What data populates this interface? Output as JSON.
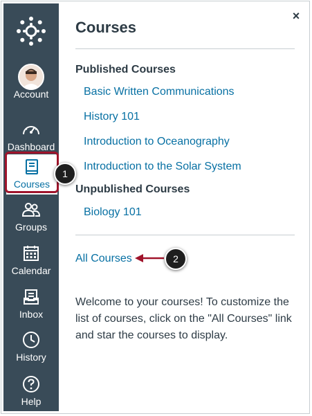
{
  "nav": {
    "items": [
      {
        "label": "Account",
        "icon": "user-avatar"
      },
      {
        "label": "Dashboard",
        "icon": "dashboard-icon"
      },
      {
        "label": "Courses",
        "icon": "courses-icon"
      },
      {
        "label": "Groups",
        "icon": "groups-icon"
      },
      {
        "label": "Calendar",
        "icon": "calendar-icon"
      },
      {
        "label": "Inbox",
        "icon": "inbox-icon"
      },
      {
        "label": "History",
        "icon": "history-icon"
      },
      {
        "label": "Help",
        "icon": "help-icon"
      }
    ]
  },
  "tray": {
    "title": "Courses",
    "close_label": "×",
    "published_heading": "Published Courses",
    "published": [
      "Basic Written Communications",
      "History 101",
      "Introduction to Oceanography",
      "Introduction to the Solar System"
    ],
    "unpublished_heading": "Unpublished Courses",
    "unpublished": [
      "Biology 101"
    ],
    "all_courses_label": "All Courses",
    "welcome_text": "Welcome to your courses! To customize the list of courses, click on the \"All Courses\" link and star the courses to display."
  },
  "callouts": [
    "1",
    "2"
  ],
  "colors": {
    "nav_bg": "#394b58",
    "link": "#0770a3",
    "highlight": "#a0142b",
    "text": "#2d3b45"
  }
}
